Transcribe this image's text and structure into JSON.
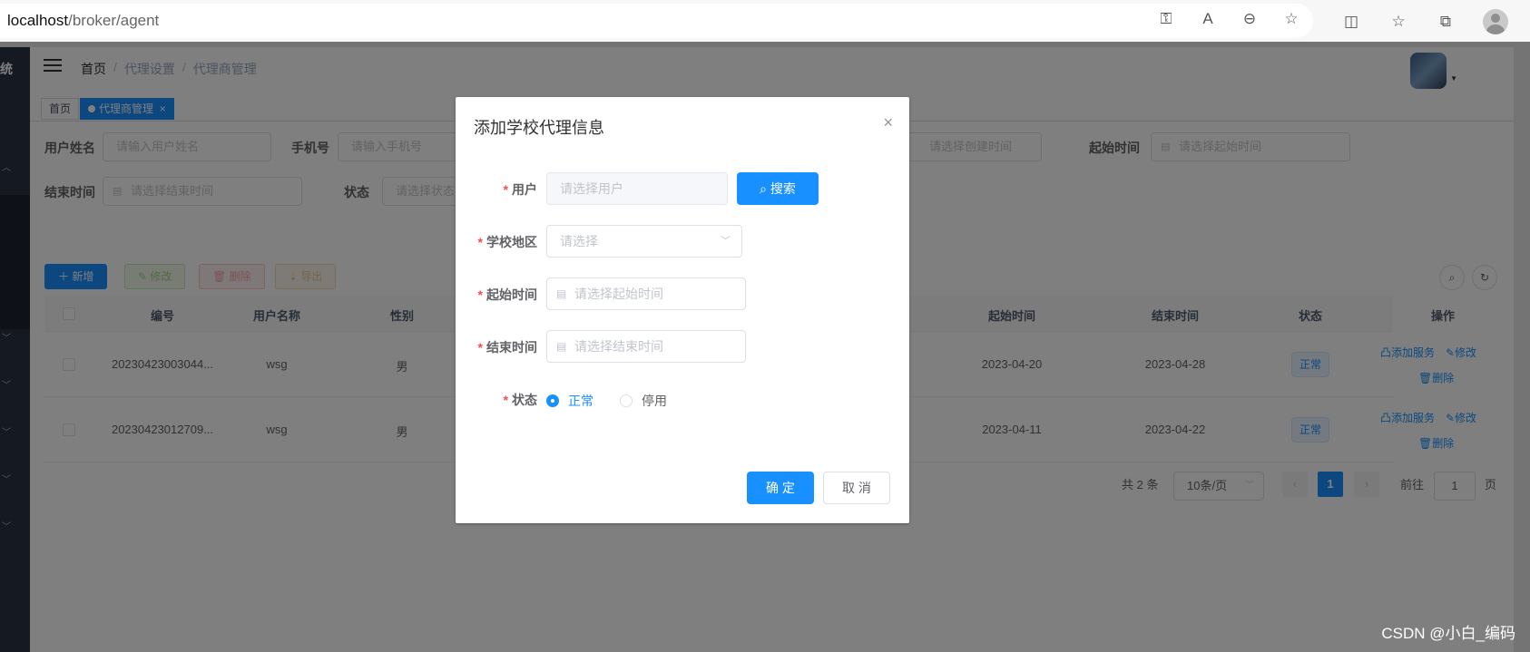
{
  "browser": {
    "url_host": "localhost",
    "url_path": "/broker/agent"
  },
  "sidebar": {
    "logo_text": "统"
  },
  "navbar": {
    "breadcrumb": [
      "首页",
      "代理设置",
      "代理商管理"
    ]
  },
  "tags": {
    "home": "首页",
    "active": "代理商管理",
    "close": "×"
  },
  "search_form": {
    "username_label": "用户姓名",
    "username_placeholder": "请输入用户姓名",
    "phone_label": "手机号",
    "phone_placeholder": "请输入手机号",
    "created_placeholder": "请选择创建时间",
    "start_label": "起始时间",
    "start_placeholder": "请选择起始时间",
    "end_label": "结束时间",
    "end_placeholder": "请选择结束时间",
    "status_label": "状态",
    "status_placeholder": "请选择状态"
  },
  "toolbar": {
    "add": "＋ 新增",
    "edit": "✎ 修改",
    "delete": "🗑 删除",
    "export": "⇣ 导出"
  },
  "table": {
    "headers": {
      "id": "编号",
      "username": "用户名称",
      "gender": "性别",
      "start": "起始时间",
      "end": "结束时间",
      "status": "状态",
      "actions": "操作"
    },
    "rows": [
      {
        "id": "20230423003044...",
        "username": "wsg",
        "gender": "男",
        "start": "2023-04-20",
        "end": "2023-04-28",
        "status": "正常"
      },
      {
        "id": "20230423012709...",
        "username": "wsg",
        "gender": "男",
        "start": "2023-04-11",
        "end": "2023-04-22",
        "status": "正常"
      }
    ],
    "action_add_service": "凸添加服务",
    "action_edit": "✎修改",
    "action_delete": "🗑删除"
  },
  "pagination": {
    "total": "共 2 条",
    "page_size": "10条/页",
    "current_page": "1",
    "goto_label": "前往",
    "goto_value": "1",
    "page_suffix": "页"
  },
  "dialog": {
    "title": "添加学校代理信息",
    "close": "×",
    "user_label": "用户",
    "user_placeholder": "请选择用户",
    "search_button": "搜索",
    "region_label": "学校地区",
    "region_placeholder": "请选择",
    "start_label": "起始时间",
    "start_placeholder": "请选择起始时间",
    "end_label": "结束时间",
    "end_placeholder": "请选择结束时间",
    "status_label": "状态",
    "status_options": [
      "正常",
      "停用"
    ],
    "confirm": "确 定",
    "cancel": "取 消"
  },
  "watermark": "CSDN @小白_编码",
  "colors": {
    "primary": "#1890ff",
    "sidebar": "#2a3242",
    "required": "#ff4949"
  }
}
